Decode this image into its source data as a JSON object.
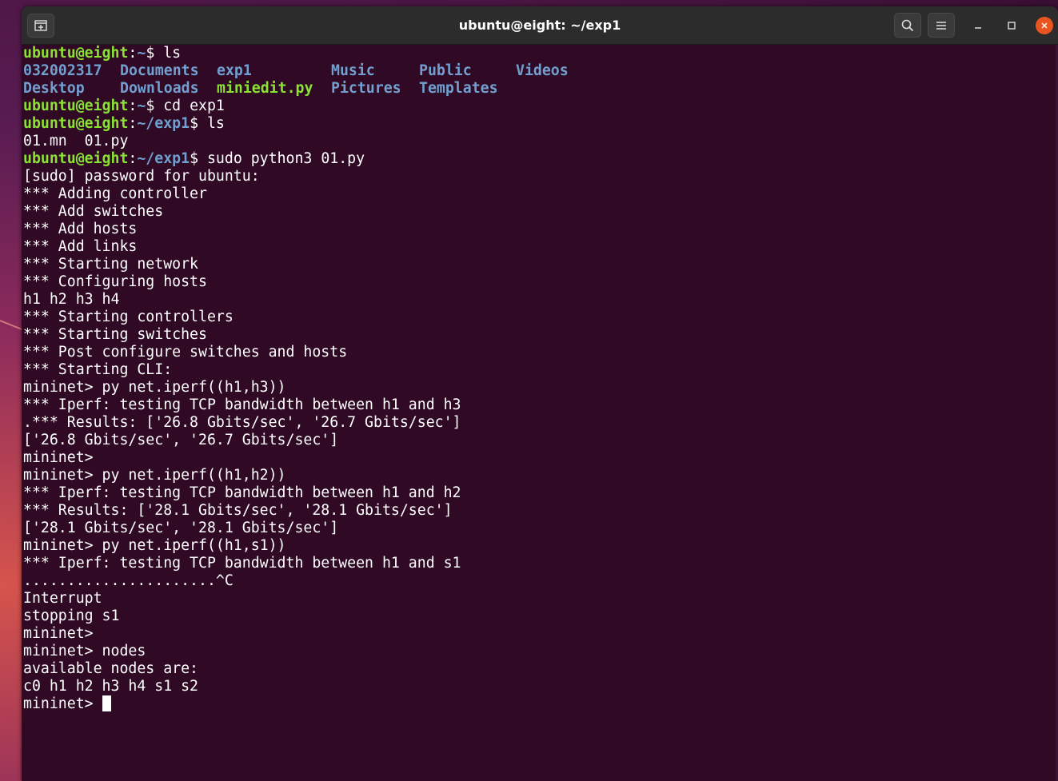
{
  "window": {
    "title": "ubuntu@eight: ~/exp1"
  },
  "prompt": {
    "user": "ubuntu@eight",
    "sep": ":",
    "home": "~",
    "exp1": "~/exp1",
    "dollar": "$ "
  },
  "ls_home": {
    "row1": [
      "032002317",
      "Documents",
      "exp1",
      "Music",
      "Public",
      "Videos"
    ],
    "row2": [
      "Desktop",
      "Downloads",
      "miniedit.py",
      "Pictures",
      "Templates"
    ]
  },
  "commands": {
    "ls": "ls",
    "cd": "cd exp1",
    "ls2": "ls",
    "run": "sudo python3 01.py"
  },
  "ls_exp1": "01.mn  01.py",
  "output": [
    "[sudo] password for ubuntu:",
    "*** Adding controller",
    "*** Add switches",
    "*** Add hosts",
    "*** Add links",
    "*** Starting network",
    "*** Configuring hosts",
    "h1 h2 h3 h4",
    "*** Starting controllers",
    "*** Starting switches",
    "*** Post configure switches and hosts",
    "*** Starting CLI:",
    "mininet> py net.iperf((h1,h3))",
    "*** Iperf: testing TCP bandwidth between h1 and h3",
    ".*** Results: ['26.8 Gbits/sec', '26.7 Gbits/sec']",
    "['26.8 Gbits/sec', '26.7 Gbits/sec']",
    "mininet>",
    "mininet> py net.iperf((h1,h2))",
    "*** Iperf: testing TCP bandwidth between h1 and h2",
    "*** Results: ['28.1 Gbits/sec', '28.1 Gbits/sec']",
    "['28.1 Gbits/sec', '28.1 Gbits/sec']",
    "mininet> py net.iperf((h1,s1))",
    "*** Iperf: testing TCP bandwidth between h1 and s1",
    "......................^C",
    "Interrupt",
    "stopping s1",
    "mininet>",
    "mininet> nodes",
    "available nodes are:",
    "c0 h1 h2 h3 h4 s1 s2"
  ],
  "final_prompt": "mininet> ",
  "colors": {
    "terminal_bg": "#300a24",
    "prompt_user": "#8ae234",
    "prompt_path": "#729fcf",
    "close_button": "#e95420"
  },
  "icons": [
    "new-tab-icon",
    "search-icon",
    "hamburger-menu-icon",
    "minimize-icon",
    "maximize-icon",
    "close-icon"
  ]
}
